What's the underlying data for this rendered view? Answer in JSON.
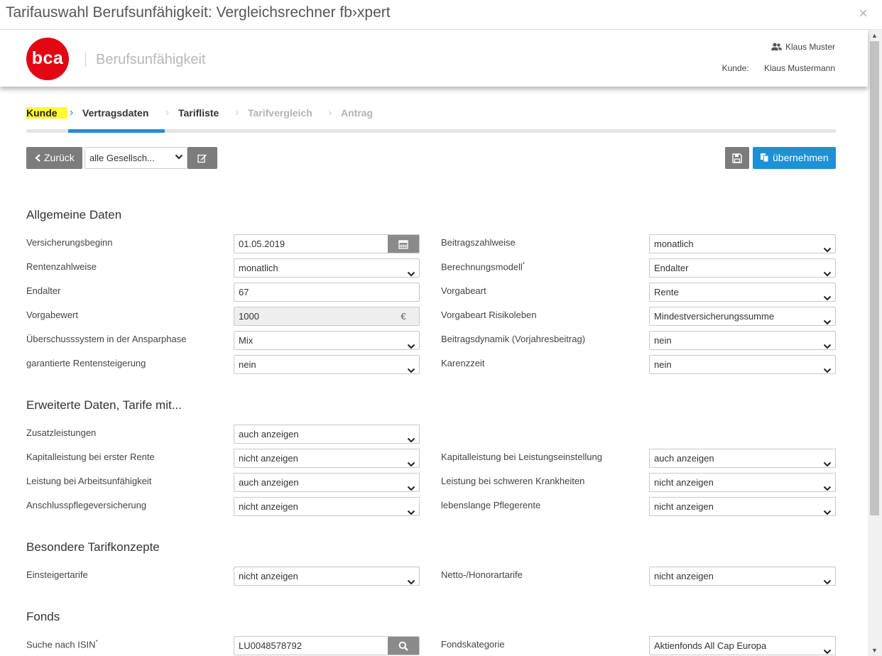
{
  "window": {
    "title": "Tarifauswahl Berufsunfähigkeit: Vergleichsrechner fb›xpert",
    "close_glyph": "×"
  },
  "header": {
    "logo_text": "bca",
    "app_title": "Berufsunfähigkeit",
    "user_name": "Klaus Muster",
    "customer_label": "Kunde:",
    "customer_name": "Klaus Mustermann"
  },
  "steps": [
    {
      "label": "Kunde",
      "state": "done"
    },
    {
      "label": "Vertragsdaten",
      "state": "active"
    },
    {
      "label": "Tarifliste",
      "state": "next"
    },
    {
      "label": "Tarifvergleich",
      "state": "disabled"
    },
    {
      "label": "Antrag",
      "state": "disabled"
    }
  ],
  "toolbar": {
    "back_label": "Zurück",
    "company_filter": "alle Gesellsch...",
    "apply_label": "übernehmen",
    "icons": {
      "back": "chevron-left-icon",
      "edit": "edit-icon",
      "save": "save-icon",
      "apply": "copy-icon"
    }
  },
  "sections": {
    "allgemein": "Allgemeine Daten",
    "erweitert": "Erweiterte Daten, Tarife mit...",
    "besondere": "Besondere Tarifkonzepte",
    "fonds": "Fonds"
  },
  "fields": {
    "versicherungsbeginn": {
      "label": "Versicherungsbeginn",
      "value": "01.05.2019"
    },
    "beitragszahlweise": {
      "label": "Beitragszahlweise",
      "value": "monatlich"
    },
    "rentenzahlweise": {
      "label": "Rentenzahlweise",
      "value": "monatlich"
    },
    "berechnungsmodell": {
      "label": "Berechnungsmodell",
      "marker": "*",
      "value": "Endalter"
    },
    "endalter": {
      "label": "Endalter",
      "value": "67"
    },
    "vorgabeart": {
      "label": "Vorgabeart",
      "value": "Rente"
    },
    "vorgabewert": {
      "label": "Vorgabewert",
      "value": "1000",
      "unit": "€"
    },
    "vorgabeart_risikoleben": {
      "label": "Vorgabeart Risikoleben",
      "value": "Mindestversicherungssumme"
    },
    "ueberschusssystem": {
      "label": "Überschusssystem in der Ansparphase",
      "value": "Mix"
    },
    "beitragsdynamik": {
      "label": "Beitragsdynamik (Vorjahresbeitrag)",
      "value": "nein"
    },
    "rentensteigerung": {
      "label": "garantierte Rentensteigerung",
      "value": "nein"
    },
    "karenzzeit": {
      "label": "Karenzzeit",
      "value": "nein"
    },
    "zusatzleistungen": {
      "label": "Zusatzleistungen",
      "value": "auch anzeigen"
    },
    "kapital_erste_rente": {
      "label": "Kapitalleistung bei erster Rente",
      "value": "nicht anzeigen"
    },
    "kapital_leistungseinstellung": {
      "label": "Kapitalleistung bei Leistungseinstellung",
      "value": "auch anzeigen"
    },
    "arbeitsunfaehigkeit": {
      "label": "Leistung bei Arbeitsunfähigkeit",
      "value": "auch anzeigen"
    },
    "schwere_krankheiten": {
      "label": "Leistung bei schweren Krankheiten",
      "value": "nicht anzeigen"
    },
    "anschlusspflege": {
      "label": "Anschlusspflegeversicherung",
      "value": "nicht anzeigen"
    },
    "lebenslange_pflegerente": {
      "label": "lebenslange Pflegerente",
      "value": "nicht anzeigen"
    },
    "einsteigertarife": {
      "label": "Einsteigertarife",
      "value": "nicht anzeigen"
    },
    "netto_honorar": {
      "label": "Netto-/Honorartarife",
      "value": "nicht anzeigen"
    },
    "isin": {
      "label": "Suche nach ISIN",
      "marker": "*",
      "value": "LU0048578792"
    },
    "fondskategorie": {
      "label": "Fondskategorie",
      "value": "Aktienfonds All Cap Europa"
    }
  },
  "colors": {
    "brand_red": "#e30613",
    "accent_blue": "#1e90d6",
    "button_grey": "#7c7c7c",
    "highlight_yellow": "#fffb30"
  }
}
